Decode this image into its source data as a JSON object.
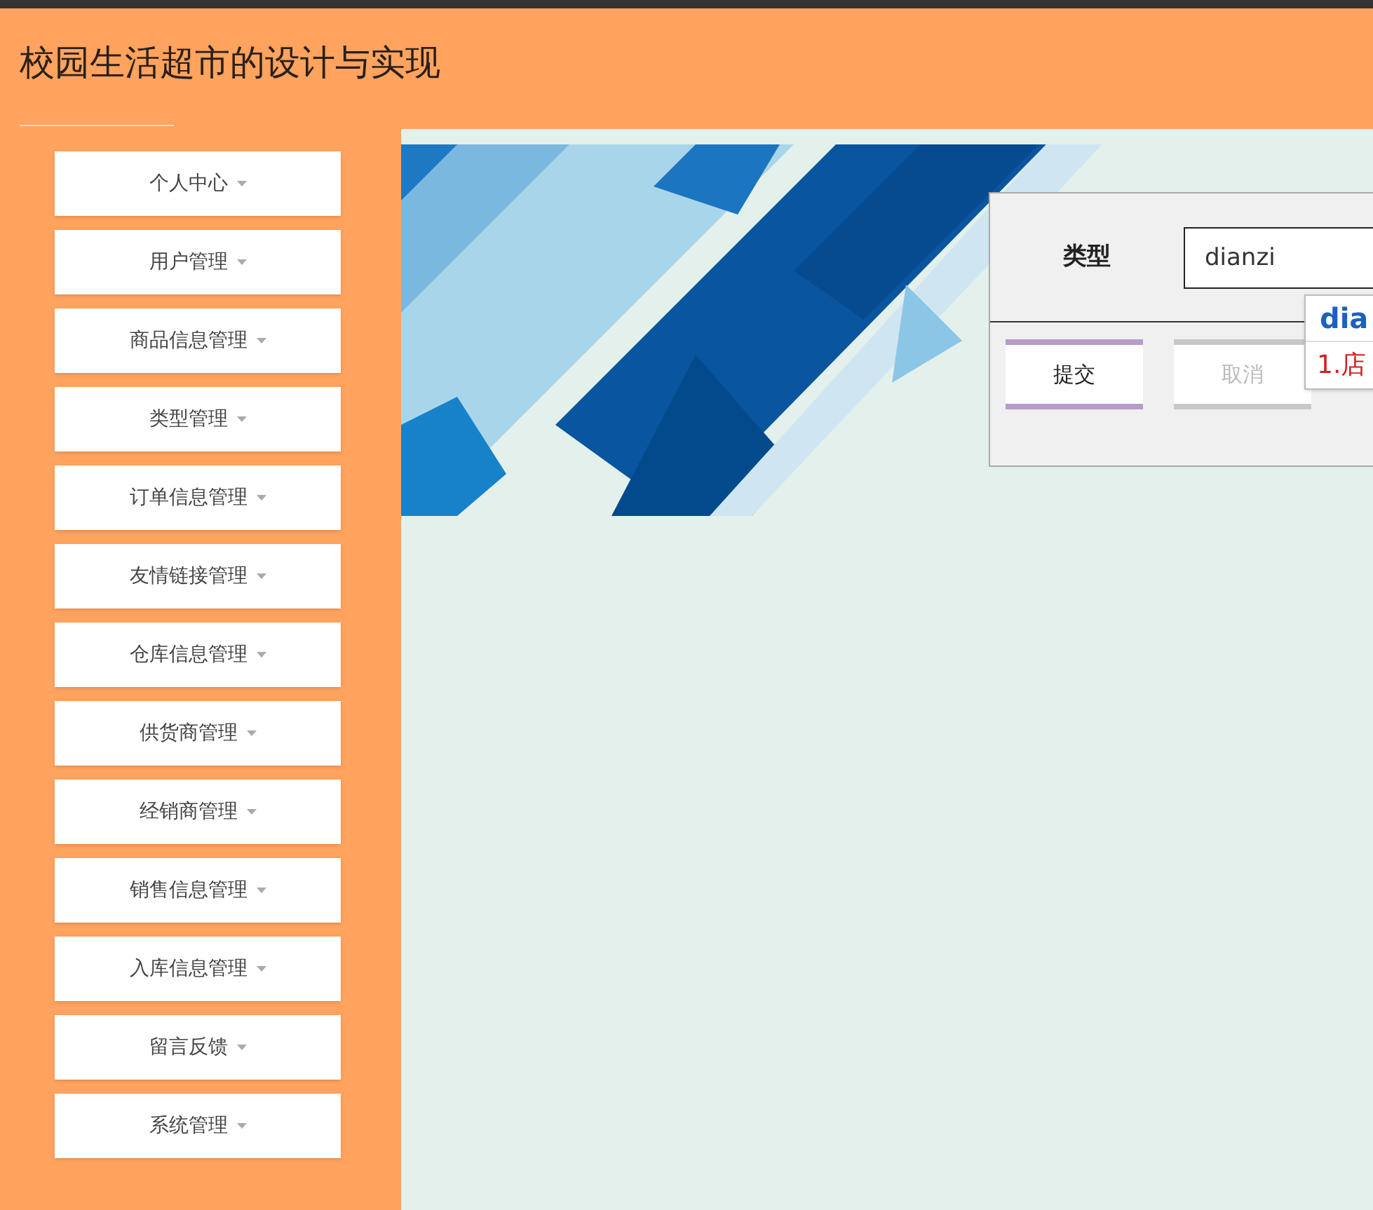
{
  "header": {
    "title": "校园生活超市的设计与实现"
  },
  "sidebar": {
    "items": [
      {
        "label": "个人中心"
      },
      {
        "label": "用户管理"
      },
      {
        "label": "商品信息管理"
      },
      {
        "label": "类型管理"
      },
      {
        "label": "订单信息管理"
      },
      {
        "label": "友情链接管理"
      },
      {
        "label": "仓库信息管理"
      },
      {
        "label": "供货商管理"
      },
      {
        "label": "经销商管理"
      },
      {
        "label": "销售信息管理"
      },
      {
        "label": "入库信息管理"
      },
      {
        "label": "留言反馈"
      },
      {
        "label": "系统管理"
      }
    ]
  },
  "form": {
    "field": {
      "label": "类型",
      "value": "dianzi"
    },
    "buttons": [
      {
        "label": "提交",
        "disabled": false
      },
      {
        "label": "取消",
        "disabled": true
      }
    ]
  },
  "ime_popup": {
    "composition": "dia",
    "candidates": [
      "1.店"
    ]
  }
}
